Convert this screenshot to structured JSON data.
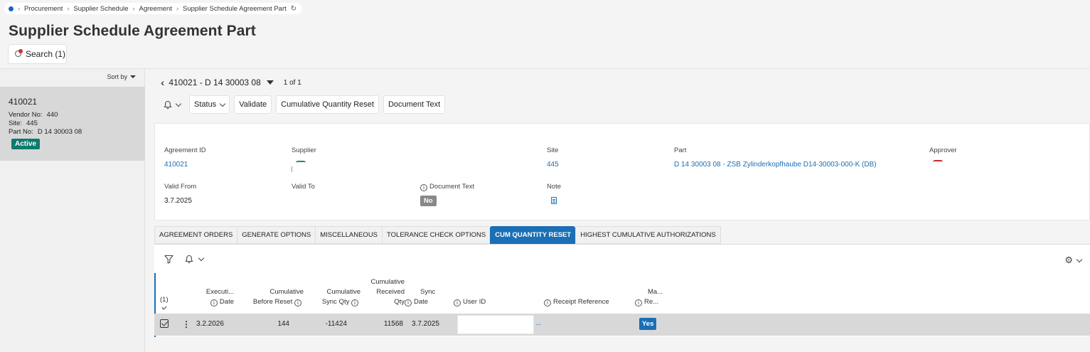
{
  "breadcrumb": {
    "items": [
      "Procurement",
      "Supplier Schedule",
      "Agreement",
      "Supplier Schedule Agreement Part"
    ]
  },
  "page": {
    "title": "Supplier Schedule Agreement Part",
    "search_label": "Search (1)"
  },
  "left_panel": {
    "sort_label": "Sort by",
    "record": {
      "id": "410021",
      "vendor_label": "Vendor No:",
      "vendor_value": "440",
      "site_label": "Site:",
      "site_value": "445",
      "part_label": "Part No:",
      "part_value": "D 14 30003 08",
      "status": "Active"
    }
  },
  "record_nav": {
    "title": "410021 - D 14 30003 08",
    "count": "1 of 1"
  },
  "toolbar": {
    "status_label": "Status",
    "validate_label": "Validate",
    "cum_reset_label": "Cumulative Quantity Reset",
    "doc_text_label": "Document Text"
  },
  "details": {
    "agreement_id_label": "Agreement ID",
    "agreement_id_value": "410021",
    "supplier_label": "Supplier",
    "site_label": "Site",
    "site_value": "445",
    "part_label": "Part",
    "part_value": "D 14 30003 08 - ZSB Zylinderkopfhaube D14-30003-000-K (DB)",
    "approver_label": "Approver",
    "valid_from_label": "Valid From",
    "valid_from_value": "3.7.2025",
    "valid_to_label": "Valid To",
    "document_text_label": "Document Text",
    "document_text_value": "No",
    "note_label": "Note"
  },
  "tabs": [
    {
      "label": "AGREEMENT ORDERS",
      "active": false
    },
    {
      "label": "GENERATE OPTIONS",
      "active": false
    },
    {
      "label": "MISCELLANEOUS",
      "active": false
    },
    {
      "label": "TOLERANCE CHECK OPTIONS",
      "active": false
    },
    {
      "label": "CUM QUANTITY RESET",
      "active": true
    },
    {
      "label": "HIGHEST CUMULATIVE AUTHORIZATIONS",
      "active": false
    }
  ],
  "grid": {
    "selection_count": "(1)",
    "columns": {
      "execution_date": [
        "Executi...",
        "Date"
      ],
      "cum_before_reset": [
        "Cumulative",
        "Before Reset"
      ],
      "cum_sync_qty": [
        "Cumulative",
        "Sync Qty"
      ],
      "cum_received_qty": [
        "Cumulative",
        "Received",
        "Qty"
      ],
      "sync_date": [
        "Sync",
        "Date"
      ],
      "user_id": "User ID",
      "receipt_reference": "Receipt Reference",
      "manual_reset": [
        "Ma...",
        "Re..."
      ]
    },
    "rows": [
      {
        "execution_date": "3.2.2026",
        "cum_before_reset": "144",
        "cum_sync_qty": "-11424",
        "cum_received_qty": "11568",
        "sync_date": "3.7.2025",
        "user_id": "",
        "receipt_reference": "...",
        "manual_reset": "Yes"
      }
    ]
  },
  "colors": {
    "accent": "#1a6fb5",
    "active_badge": "#0e7a6d",
    "no_badge": "#888888"
  },
  "icons": [
    "refresh-icon",
    "search-icon",
    "bell-icon",
    "filter-icon",
    "gear-icon",
    "note-icon",
    "info-icon",
    "kebab-icon"
  ]
}
